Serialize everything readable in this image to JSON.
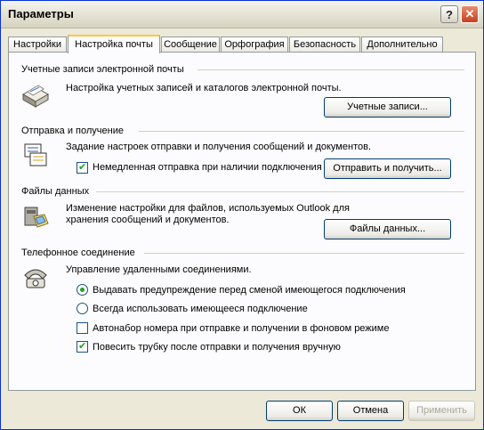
{
  "window": {
    "title": "Параметры"
  },
  "tabs": [
    {
      "label": "Настройки",
      "active": false
    },
    {
      "label": "Настройка почты",
      "active": true
    },
    {
      "label": "Сообщение",
      "active": false
    },
    {
      "label": "Орфография",
      "active": false
    },
    {
      "label": "Безопасность",
      "active": false
    },
    {
      "label": "Дополнительно",
      "active": false
    }
  ],
  "accounts": {
    "heading": "Учетные записи электронной почты",
    "description": "Настройка учетных записей и каталогов электронной почты.",
    "button": "Учетные записи..."
  },
  "sendreceive": {
    "heading": "Отправка и получение",
    "description": "Задание настроек отправки и получения сообщений и документов.",
    "immediate_send_label": "Немедленная отправка при наличии подключения",
    "immediate_send_checked": true,
    "button": "Отправить и получить..."
  },
  "datafiles": {
    "heading": "Файлы данных",
    "description_line1": "Изменение настройки для файлов, используемых Outlook для",
    "description_line2": "хранения сообщений и документов.",
    "button": "Файлы данных..."
  },
  "dialup": {
    "heading": "Телефонное соединение",
    "description": "Управление удаленными соединениями.",
    "options": [
      {
        "label": "Выдавать предупреждение перед сменой имеющегося подключения",
        "selected": true
      },
      {
        "label": "Всегда использовать имеющееся подключение",
        "selected": false
      }
    ],
    "checkboxes": [
      {
        "label": "Автонабор номера при отправке и получении в фоновом режиме",
        "checked": false
      },
      {
        "label": "Повесить трубку после отправки и получения вручную",
        "checked": true
      }
    ]
  },
  "footer": {
    "ok": "ОК",
    "cancel": "Отмена",
    "apply": "Применить"
  }
}
